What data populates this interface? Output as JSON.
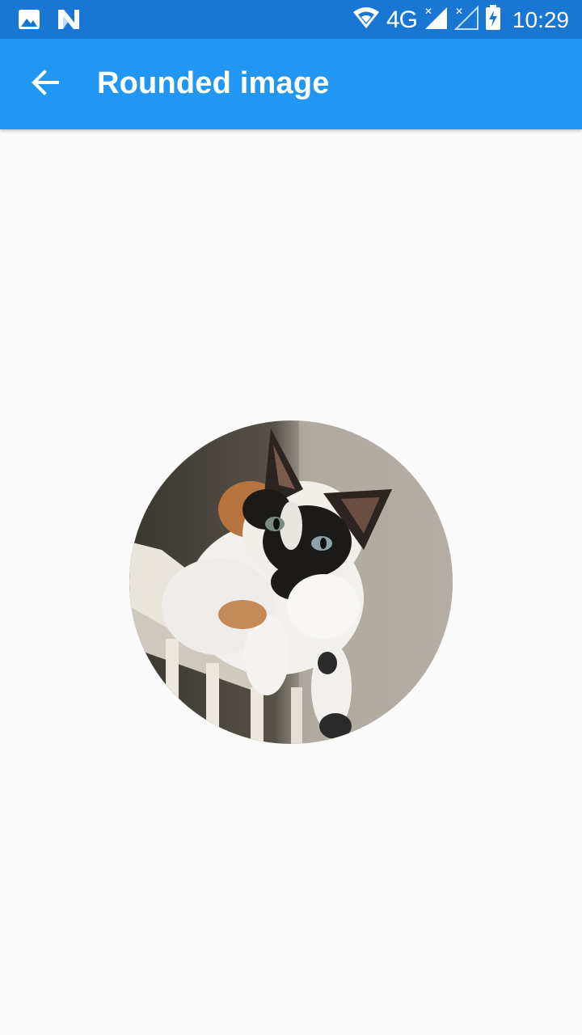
{
  "status_bar": {
    "left_icons": [
      "image-icon",
      "n-app-icon"
    ],
    "right_icons": [
      "wifi-icon",
      "signal-icon",
      "signal-no-sim-icon",
      "battery-charging-icon"
    ],
    "network": "4G",
    "time": "10:29"
  },
  "app_bar": {
    "back_icon": "arrow-back-icon",
    "title": "Rounded image"
  },
  "content": {
    "image": {
      "subject": "calico-cat",
      "shape": "circle"
    }
  },
  "colors": {
    "status_bar": "#1976d2",
    "app_bar": "#2196f3",
    "background": "#fafafa",
    "on_primary": "#ffffff"
  }
}
